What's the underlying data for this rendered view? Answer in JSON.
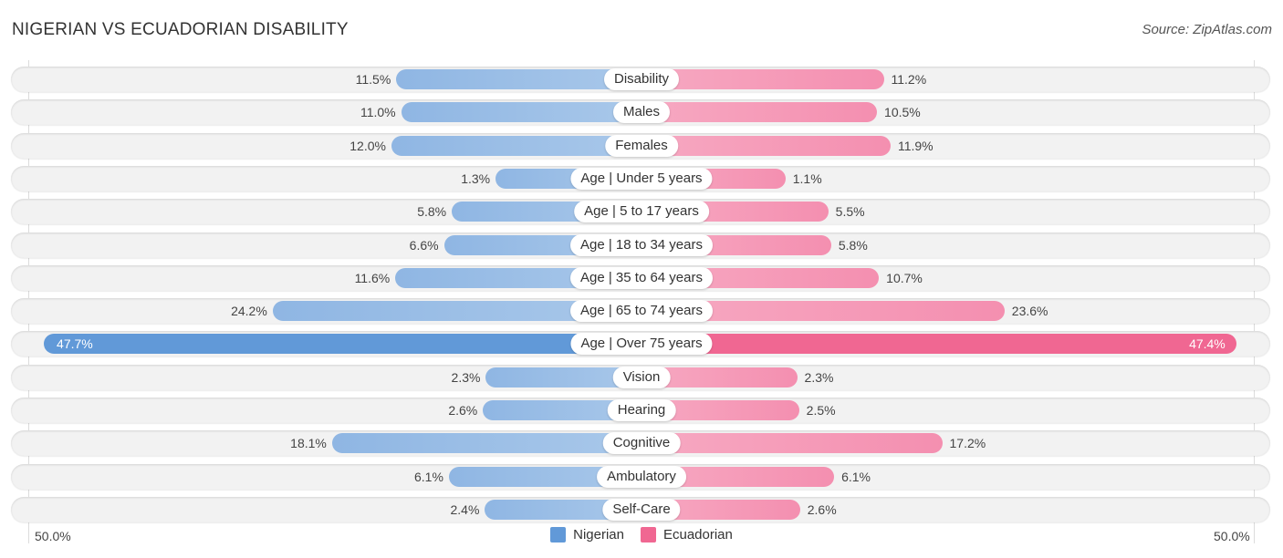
{
  "title": "NIGERIAN VS ECUADORIAN DISABILITY",
  "source": "Source: ZipAtlas.com",
  "colors": {
    "nigerian": "#6199d8",
    "ecuadorian": "#f06792"
  },
  "chart_data": {
    "type": "bar",
    "orientation": "horizontal-diverging",
    "title": "NIGERIAN VS ECUADORIAN DISABILITY",
    "xlim": [
      -50,
      50
    ],
    "axis_labels": {
      "left": "50.0%",
      "right": "50.0%"
    },
    "legend": {
      "position": "bottom-center",
      "entries": [
        "Nigerian",
        "Ecuadorian"
      ]
    },
    "categories": [
      "Disability",
      "Males",
      "Females",
      "Age | Under 5 years",
      "Age | 5 to 17 years",
      "Age | 18 to 34 years",
      "Age | 35 to 64 years",
      "Age | 65 to 74 years",
      "Age | Over 75 years",
      "Vision",
      "Hearing",
      "Cognitive",
      "Ambulatory",
      "Self-Care"
    ],
    "series": [
      {
        "name": "Nigerian",
        "side": "left",
        "values": [
          11.5,
          11.0,
          12.0,
          1.3,
          5.8,
          6.6,
          11.6,
          24.2,
          47.7,
          2.3,
          2.6,
          18.1,
          6.1,
          2.4
        ],
        "labels": [
          "11.5%",
          "11.0%",
          "12.0%",
          "1.3%",
          "5.8%",
          "6.6%",
          "11.6%",
          "24.2%",
          "47.7%",
          "2.3%",
          "2.6%",
          "18.1%",
          "6.1%",
          "2.4%"
        ]
      },
      {
        "name": "Ecuadorian",
        "side": "right",
        "values": [
          11.2,
          10.5,
          11.9,
          1.1,
          5.5,
          5.8,
          10.7,
          23.6,
          47.4,
          2.3,
          2.5,
          17.2,
          6.1,
          2.6
        ],
        "labels": [
          "11.2%",
          "10.5%",
          "11.9%",
          "1.1%",
          "5.5%",
          "5.8%",
          "10.7%",
          "23.6%",
          "47.4%",
          "2.3%",
          "2.5%",
          "17.2%",
          "6.1%",
          "2.6%"
        ]
      }
    ]
  }
}
